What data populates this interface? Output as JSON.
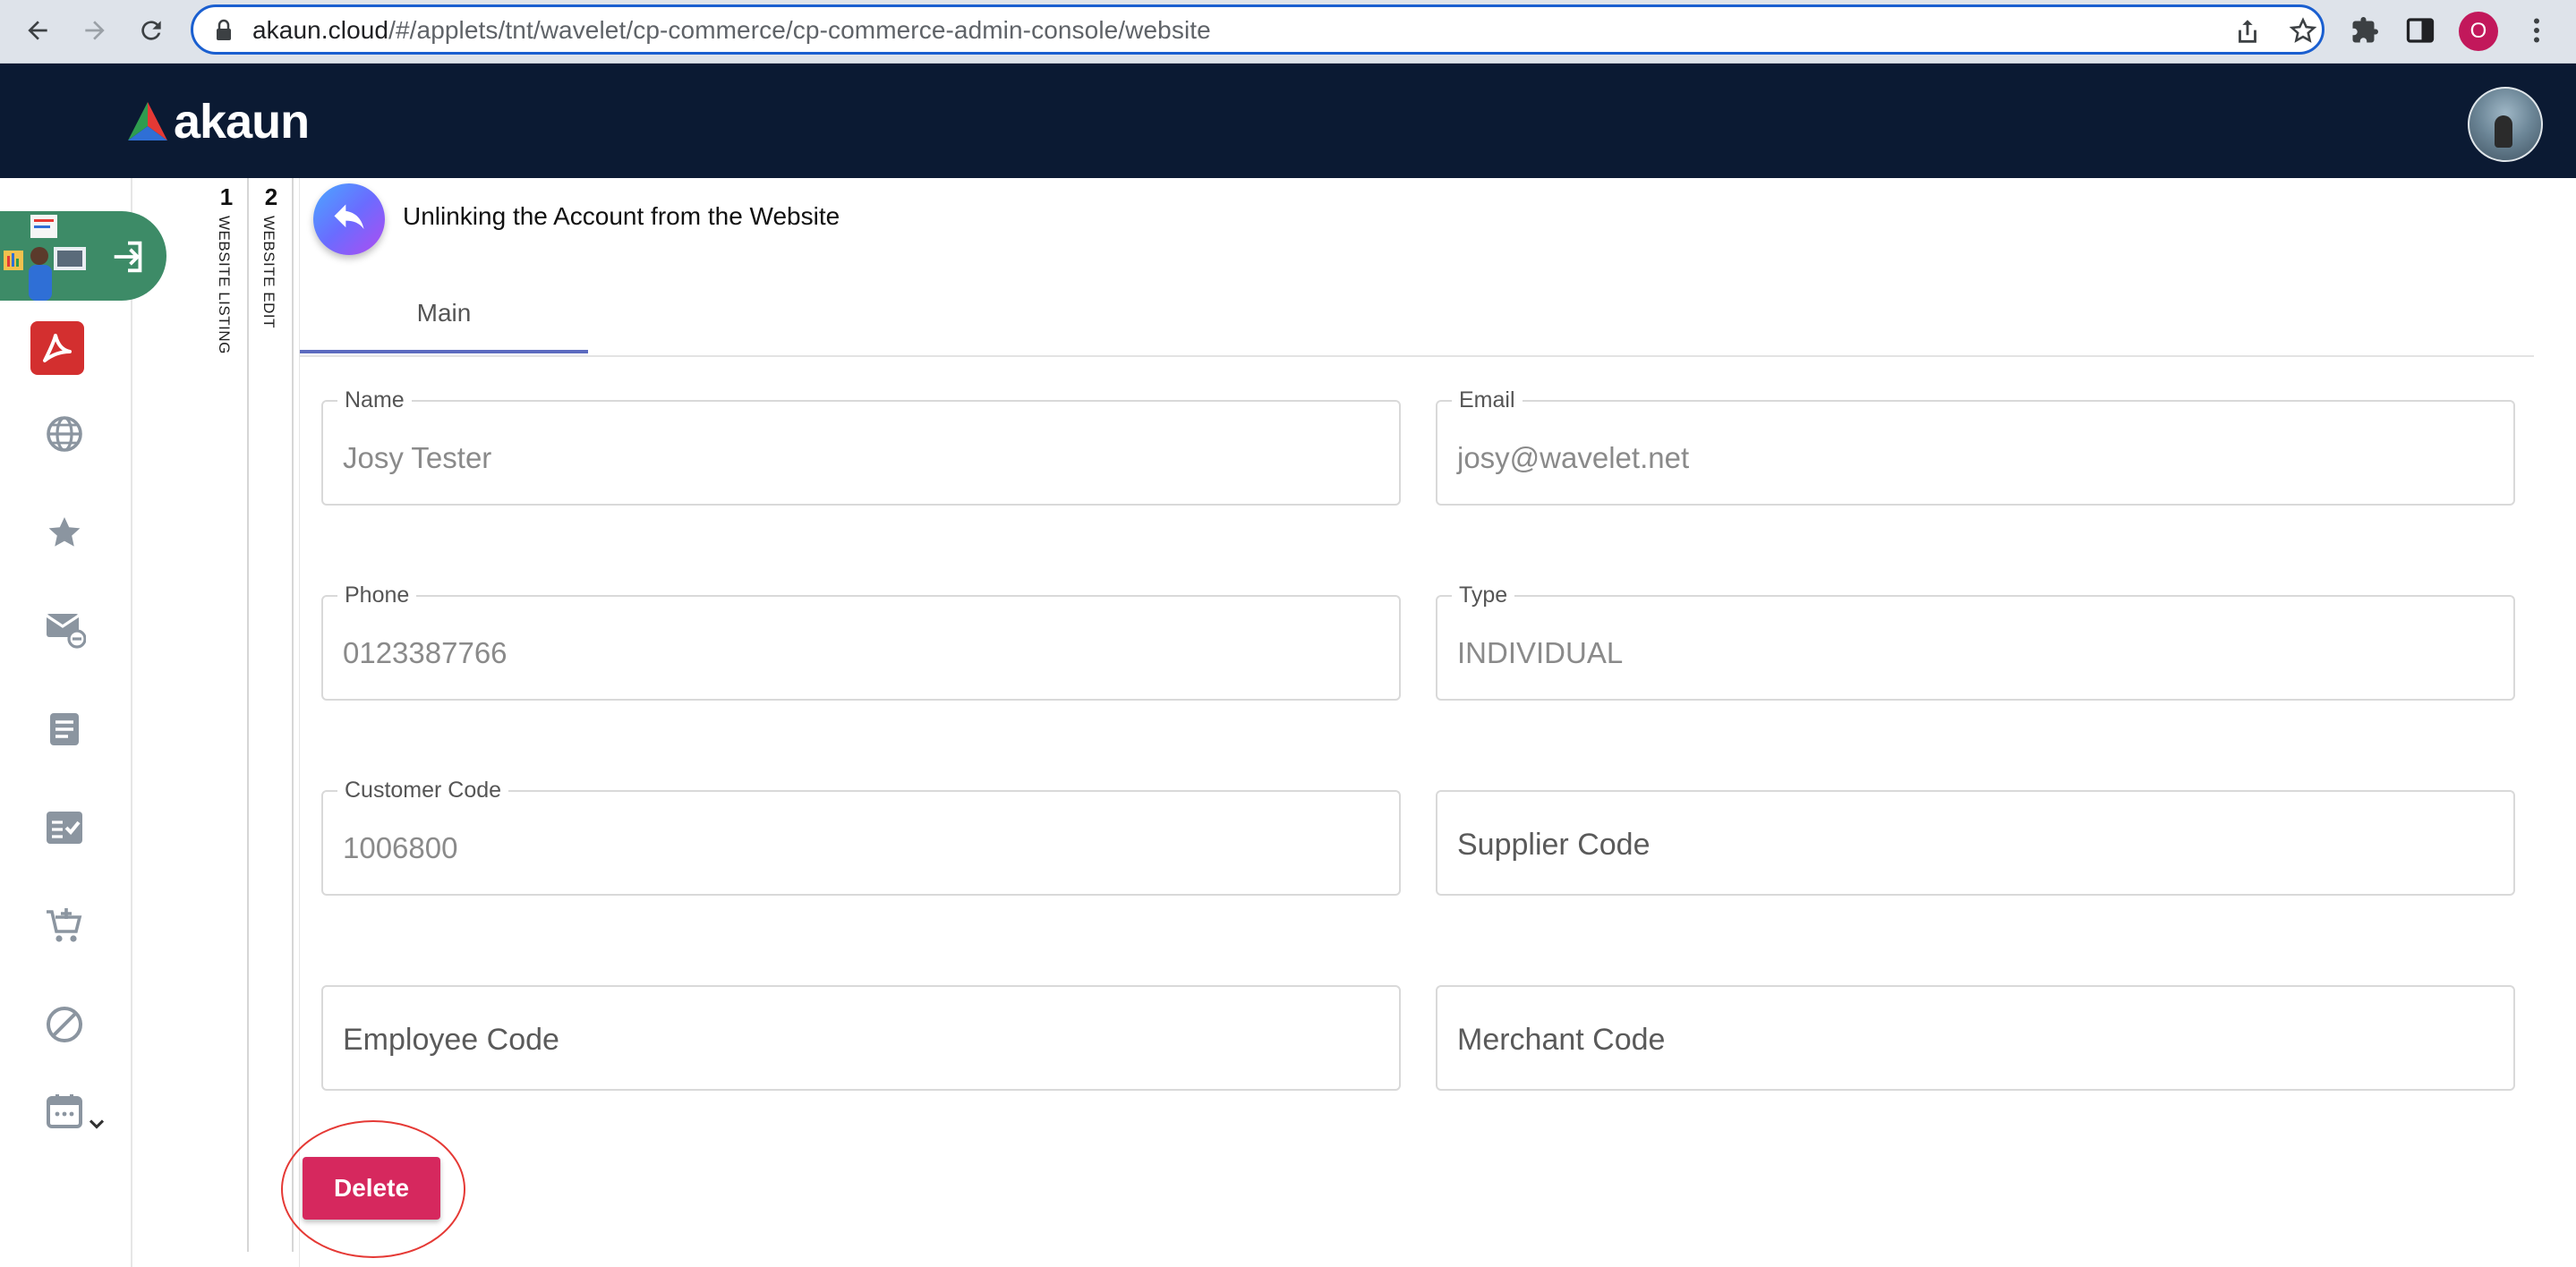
{
  "browser": {
    "url_host": "akaun.cloud",
    "url_path": "/#/applets/tnt/wavelet/cp-commerce/cp-commerce-admin-console/website",
    "profile_initial": "O"
  },
  "app": {
    "logo_text": "akaun"
  },
  "steps": [
    {
      "number": "1",
      "label": "WEBSITE LISTING"
    },
    {
      "number": "2",
      "label": "WEBSITE EDIT"
    }
  ],
  "page": {
    "title": "Unlinking the Account from the Website",
    "tabs": [
      {
        "label": "Main"
      }
    ]
  },
  "form": {
    "name": {
      "label": "Name",
      "value": "Josy Tester"
    },
    "email": {
      "label": "Email",
      "value": "josy@wavelet.net"
    },
    "phone": {
      "label": "Phone",
      "value": "0123387766"
    },
    "type": {
      "label": "Type",
      "value": "INDIVIDUAL"
    },
    "customer_code": {
      "label": "Customer Code",
      "value": "1006800"
    },
    "supplier_code": {
      "placeholder": "Supplier Code"
    },
    "employee_code": {
      "placeholder": "Employee Code"
    },
    "merchant_code": {
      "placeholder": "Merchant Code"
    }
  },
  "actions": {
    "delete_label": "Delete"
  },
  "colors": {
    "header_bg": "#0b1a33",
    "delete_button": "#d6285e",
    "tab_indicator": "#5c6bc0",
    "launcher_green": "#3d8b67"
  },
  "sidebar_icons": [
    "acrobat-icon",
    "globe-icon",
    "star-icon",
    "mail-icon",
    "document-icon",
    "checklist-icon",
    "cart-icon",
    "block-icon",
    "calendar-icon"
  ]
}
